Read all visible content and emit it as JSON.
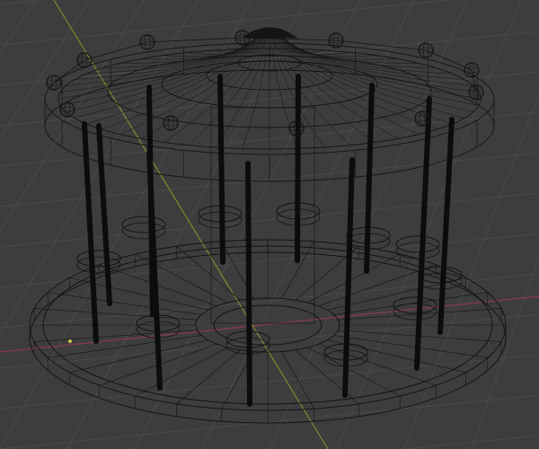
{
  "viewport": {
    "mode": "wireframe",
    "object": "carousel",
    "colors": {
      "background": "#3d3d3d",
      "grid": "#4a4a4a",
      "x_axis": "#8a3b48",
      "y_axis": "#7b8a2e",
      "wire": "#141414",
      "pole": "#0c0c0c"
    },
    "icons": [
      "origin-point-icon"
    ]
  }
}
